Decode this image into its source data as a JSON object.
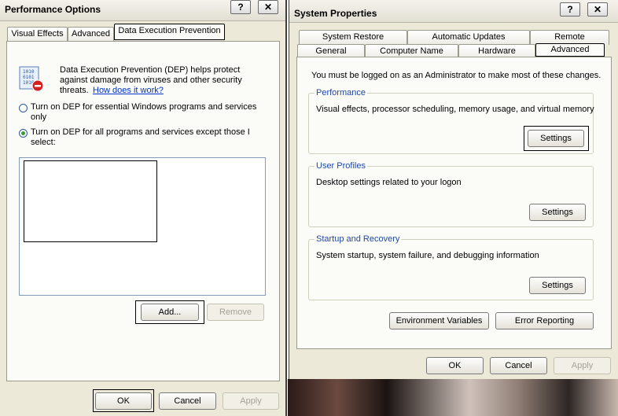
{
  "perf": {
    "title": "Performance Options",
    "help_btn": "?",
    "close_btn": "✕",
    "tabs": [
      "Visual Effects",
      "Advanced",
      "Data Execution Prevention"
    ],
    "dep_desc_1": "Data Execution Prevention (DEP) helps protect",
    "dep_desc_2": "against damage from viruses and other security",
    "dep_desc_3": "threats.",
    "link": "How does it work?",
    "radio1_line1": "Turn on DEP for essential Windows programs and services",
    "radio1_line2": "only",
    "radio2_line1": "Turn on DEP for all programs and services except those I",
    "radio2_line2": "select:",
    "add_btn": "Add...",
    "remove_btn": "Remove",
    "ok_btn": "OK",
    "cancel_btn": "Cancel",
    "apply_btn": "Apply"
  },
  "sys": {
    "title": "System Properties",
    "help_btn": "?",
    "close_btn": "✕",
    "tabs_row1": [
      "System Restore",
      "Automatic Updates",
      "Remote"
    ],
    "tabs_row2": [
      "General",
      "Computer Name",
      "Hardware",
      "Advanced"
    ],
    "admin_note": "You must be logged on as an Administrator to make most of these changes.",
    "performance": {
      "legend": "Performance",
      "desc": "Visual effects, processor scheduling, memory usage, and virtual memory",
      "btn": "Settings"
    },
    "profiles": {
      "legend": "User Profiles",
      "desc": "Desktop settings related to your logon",
      "btn": "Settings"
    },
    "startup": {
      "legend": "Startup and Recovery",
      "desc": "System startup, system failure, and debugging information",
      "btn": "Settings"
    },
    "env_btn": "Environment Variables",
    "err_btn": "Error Reporting",
    "ok_btn": "OK",
    "cancel_btn": "Cancel",
    "apply_btn": "Apply"
  }
}
